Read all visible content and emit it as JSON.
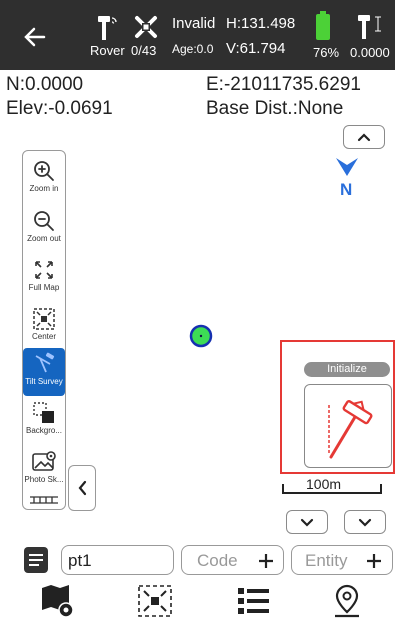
{
  "status": {
    "mode": "Rover",
    "satellites": "0/43",
    "solution": "Invalid",
    "age": "Age:0.0",
    "h_precision": "H:131.498",
    "v_precision": "V:61.794",
    "battery": "76%",
    "antenna_height": "0.0000"
  },
  "coords": {
    "north": "N:0.0000",
    "east": "E:-21011735.6291",
    "elev": "Elev:-0.0691",
    "base_dist": "Base Dist.:None"
  },
  "tools": [
    {
      "label": "Zoom in",
      "icon": "zoom-in-icon"
    },
    {
      "label": "Zoom out",
      "icon": "zoom-out-icon"
    },
    {
      "label": "Full Map",
      "icon": "full-map-icon"
    },
    {
      "label": "Center",
      "icon": "center-icon"
    },
    {
      "label": "Tilt Survey",
      "icon": "tilt-survey-icon"
    },
    {
      "label": "Backgro...",
      "icon": "background-icon"
    },
    {
      "label": "Photo Sk...",
      "icon": "photo-sketch-icon"
    }
  ],
  "compass": {
    "label": "N"
  },
  "tilt": {
    "initialize_label": "Initialize"
  },
  "scale": {
    "label": "100m"
  },
  "bottom": {
    "point_name": "pt1",
    "code_placeholder": "Code",
    "entity_placeholder": "Entity"
  },
  "colors": {
    "top_bar": "#2f2f2f",
    "battery": "#4cd137",
    "active_tool": "#1565c0",
    "highlight": "#e53935",
    "compass": "#2a6fdb",
    "position_marker": "#3ddc55"
  }
}
